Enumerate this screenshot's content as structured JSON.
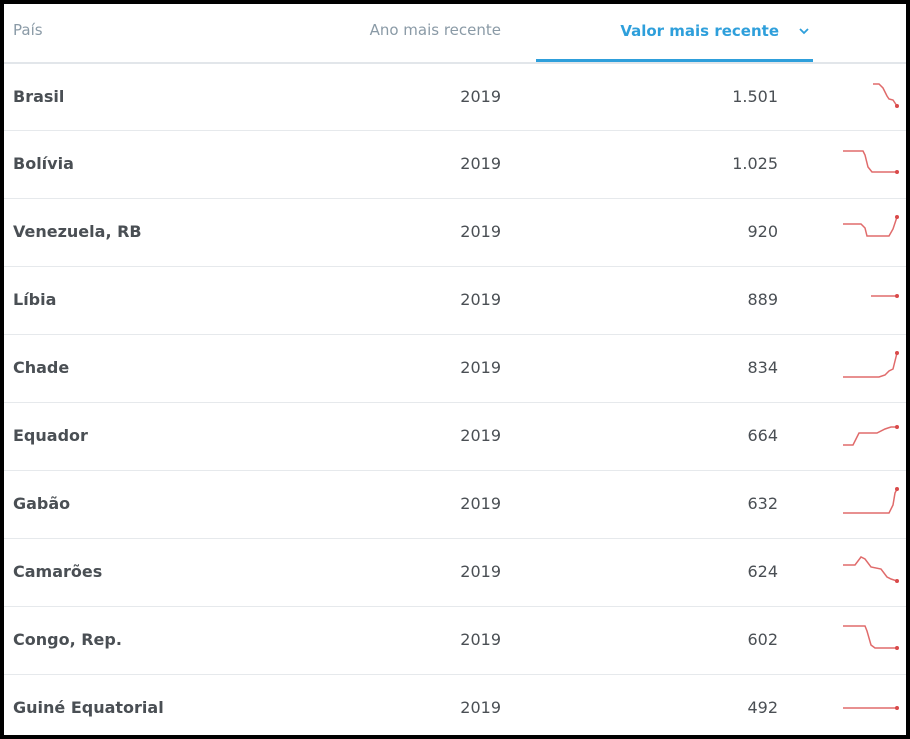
{
  "header": {
    "country_label": "País",
    "year_label": "Ano mais recente",
    "value_label": "Valor mais recente"
  },
  "colors": {
    "accent": "#2e9fdb",
    "sparkline": "#e06b6b"
  },
  "rows": [
    {
      "country": "Brasil",
      "year": "2019",
      "value": "1.501",
      "trend": "falling"
    },
    {
      "country": "Bolívia",
      "year": "2019",
      "value": "1.025",
      "trend": "step-down"
    },
    {
      "country": "Venezuela, RB",
      "year": "2019",
      "value": "920",
      "trend": "dip-then-rise"
    },
    {
      "country": "Líbia",
      "year": "2019",
      "value": "889",
      "trend": "flat"
    },
    {
      "country": "Chade",
      "year": "2019",
      "value": "834",
      "trend": "rising"
    },
    {
      "country": "Equador",
      "year": "2019",
      "value": "664",
      "trend": "step-up"
    },
    {
      "country": "Gabão",
      "year": "2019",
      "value": "632",
      "trend": "sharp-rise"
    },
    {
      "country": "Camarões",
      "year": "2019",
      "value": "624",
      "trend": "bump-then-fall"
    },
    {
      "country": "Congo, Rep.",
      "year": "2019",
      "value": "602",
      "trend": "step-down"
    },
    {
      "country": "Guiné Equatorial",
      "year": "2019",
      "value": "492",
      "trend": "flat"
    }
  ]
}
